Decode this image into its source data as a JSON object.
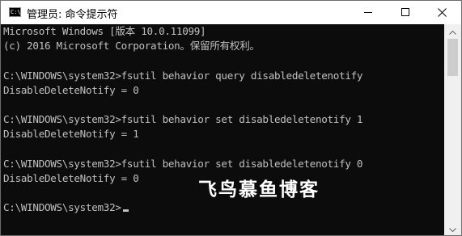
{
  "window": {
    "title": "管理员: 命令提示符",
    "icon_glyph": "C:\\",
    "icon": "cmd-icon",
    "controls": [
      "minimize-icon",
      "maximize-icon",
      "close-icon"
    ]
  },
  "console": {
    "lines": [
      "Microsoft Windows [版本 10.0.11099]",
      "(c) 2016 Microsoft Corporation。保留所有权利。",
      "",
      "C:\\WINDOWS\\system32>fsutil behavior query disabledeletenotify",
      "DisableDeleteNotify = 0",
      "",
      "C:\\WINDOWS\\system32>fsutil behavior set disabledeletenotify 1",
      "DisableDeleteNotify = 1",
      "",
      "C:\\WINDOWS\\system32>fsutil behavior set disabledeletenotify 0",
      "DisableDeleteNotify = 0",
      "",
      "C:\\WINDOWS\\system32>"
    ],
    "text_color": "#c0c0c0",
    "background_color": "#0c0c0c"
  },
  "watermark": "飞鸟慕鱼博客"
}
